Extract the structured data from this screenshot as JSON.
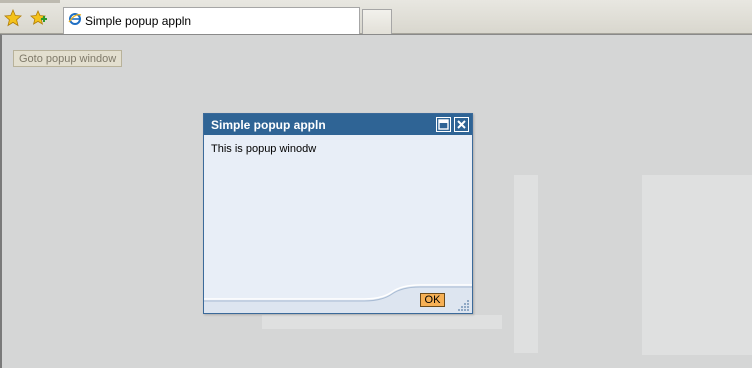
{
  "browser": {
    "tab_title": "Simple popup appln",
    "icons": [
      "favorites-star-icon",
      "add-favorite-icon",
      "ie-page-icon"
    ]
  },
  "page": {
    "goto_button_label": "Goto popup window"
  },
  "popup": {
    "title": "Simple popup appln",
    "message": "This is popup winodw",
    "ok_label": "OK",
    "header_color": "#2f6495",
    "body_color": "#e8eef7",
    "ok_color": "#f6b055"
  }
}
